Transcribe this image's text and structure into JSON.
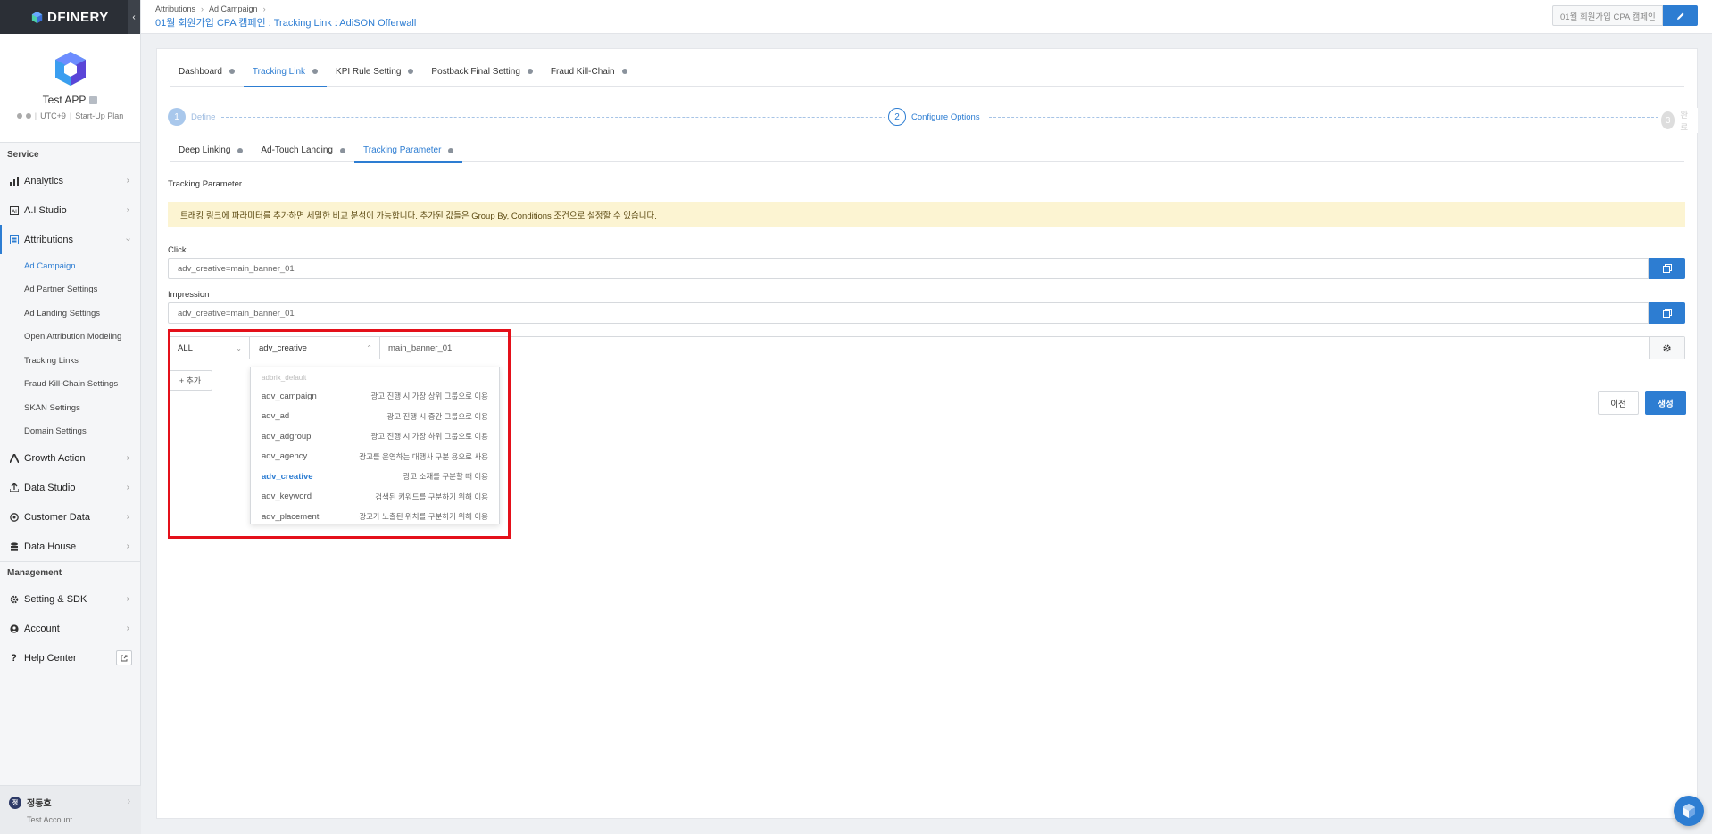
{
  "brand": {
    "name": "DFINERY",
    "collapse_icon": "chevron-left-icon"
  },
  "app": {
    "name": "Test APP",
    "timezone": "UTC+9",
    "plan": "Start-Up Plan"
  },
  "sidebar": {
    "service_title": "Service",
    "management_title": "Management",
    "service_items": [
      {
        "label": "Analytics",
        "icon": "bar-chart-icon"
      },
      {
        "label": "A.I Studio",
        "icon": "ai-icon"
      },
      {
        "label": "Attributions",
        "icon": "attribution-icon"
      }
    ],
    "attribution_sub": [
      {
        "label": "Ad Campaign"
      },
      {
        "label": "Ad Partner Settings"
      },
      {
        "label": "Ad Landing Settings"
      },
      {
        "label": "Open Attribution Modeling"
      },
      {
        "label": "Tracking Links"
      },
      {
        "label": "Fraud Kill-Chain Settings"
      },
      {
        "label": "SKAN Settings"
      },
      {
        "label": "Domain Settings"
      }
    ],
    "service_items_2": [
      {
        "label": "Growth Action",
        "icon": "growth-icon"
      },
      {
        "label": "Data Studio",
        "icon": "upload-icon"
      },
      {
        "label": "Customer Data",
        "icon": "target-icon"
      },
      {
        "label": "Data House",
        "icon": "database-icon"
      }
    ],
    "management_items": [
      {
        "label": "Setting & SDK",
        "icon": "gear-icon"
      },
      {
        "label": "Account",
        "icon": "user-icon"
      },
      {
        "label": "Help Center",
        "icon": "question-icon"
      }
    ]
  },
  "user": {
    "avatar_initial": "정",
    "name": "정동호",
    "account": "Test Account"
  },
  "header": {
    "breadcrumb": [
      "Attributions",
      "Ad Campaign"
    ],
    "title": "01월 회원가입 CPA 캠페인 : Tracking Link : AdiSON Offerwall",
    "title_input_value": "01월 회원가입 CPA 캠페인"
  },
  "tabs": [
    "Dashboard",
    "Tracking Link",
    "KPI Rule Setting",
    "Postback Final Setting",
    "Fraud Kill-Chain"
  ],
  "active_tab": "Tracking Link",
  "stepper": [
    {
      "num": "1",
      "label": "Define"
    },
    {
      "num": "2",
      "label": "Configure Options"
    },
    {
      "num": "3",
      "label": "완료"
    }
  ],
  "subtabs": [
    "Deep Linking",
    "Ad-Touch Landing",
    "Tracking Parameter"
  ],
  "active_subtab": "Tracking Parameter",
  "section_label": "Tracking Parameter",
  "notice": "트래킹 링크에 파라미터를 추가하면 세밀한 비교 분석이 가능합니다. 추가된 값들은 Group By, Conditions 조건으로 설정할 수 있습니다.",
  "click": {
    "label": "Click",
    "value": "adv_creative=main_banner_01"
  },
  "impression": {
    "label": "Impression",
    "value": "adv_creative=main_banner_01"
  },
  "param_row": {
    "scope": "ALL",
    "key": "adv_creative",
    "value": "main_banner_01"
  },
  "add_button": "+ 추가",
  "dropdown": {
    "header": "adbrix_default",
    "selected": "adv_creative",
    "items": [
      {
        "key": "adv_campaign",
        "desc": "광고 진행 시 가장 상위 그룹으로 이용"
      },
      {
        "key": "adv_ad",
        "desc": "광고 진행 시 중간 그룹으로 이용"
      },
      {
        "key": "adv_adgroup",
        "desc": "광고 진행 시 가장 하위 그룹으로 이용"
      },
      {
        "key": "adv_agency",
        "desc": "광고를 운영하는 대행사 구분 용으로 사용"
      },
      {
        "key": "adv_creative",
        "desc": "광고 소재를 구분할 때 이용"
      },
      {
        "key": "adv_keyword",
        "desc": "검색된 키워드를 구분하기 위해 이용"
      },
      {
        "key": "adv_placement",
        "desc": "광고가 노출된 위치를 구분하기 위해 이용"
      }
    ]
  },
  "buttons": {
    "prev": "이전",
    "create": "생성"
  },
  "colors": {
    "accent": "#2d7dd2",
    "highlight": "#e4101a",
    "notice_bg": "#fcf4d2",
    "brand_bar": "#2b2f36"
  }
}
